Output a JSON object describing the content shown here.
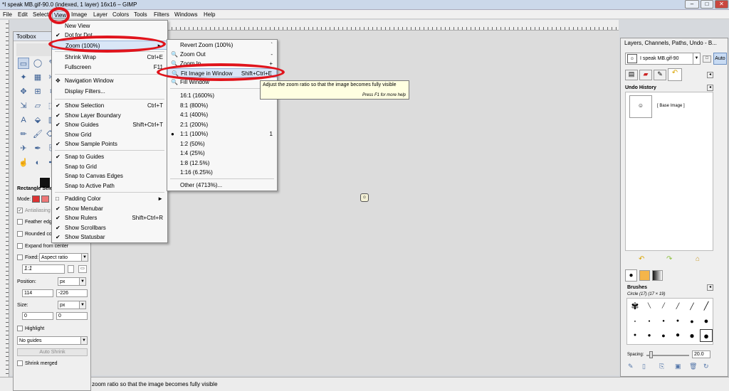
{
  "window": {
    "title": "*I speak MB.gif-90.0 (indexed, 1 layer) 16x16 – GIMP"
  },
  "menubar": {
    "items": [
      "File",
      "Edit",
      "Select",
      "View",
      "Image",
      "Layer",
      "Colors",
      "Tools",
      "Filters",
      "Windows",
      "Help"
    ]
  },
  "view_menu": {
    "items": [
      {
        "label": "New View",
        "check": ""
      },
      {
        "label": "Dot for Dot",
        "check": "✔"
      },
      {
        "label": "Zoom (100%)",
        "check": "",
        "sub": "►"
      },
      {
        "label": "Shrink Wrap",
        "shortcut": "Ctrl+E",
        "check": ""
      },
      {
        "label": "Fullscreen",
        "shortcut": "F11",
        "check": ""
      },
      {
        "label": "Navigation Window",
        "check": "✥"
      },
      {
        "label": "Display Filters...",
        "check": ""
      },
      {
        "label": "Show Selection",
        "shortcut": "Ctrl+T",
        "check": "✔"
      },
      {
        "label": "Show Layer Boundary",
        "check": "✔"
      },
      {
        "label": "Show Guides",
        "shortcut": "Shift+Ctrl+T",
        "check": "✔"
      },
      {
        "label": "Show Grid",
        "check": ""
      },
      {
        "label": "Show Sample Points",
        "check": "✔"
      },
      {
        "label": "Snap to Guides",
        "check": "✔"
      },
      {
        "label": "Snap to Grid",
        "check": ""
      },
      {
        "label": "Snap to Canvas Edges",
        "check": ""
      },
      {
        "label": "Snap to Active Path",
        "check": ""
      },
      {
        "label": "Padding Color",
        "check": "□",
        "sub": "►"
      },
      {
        "label": "Show Menubar",
        "check": "✔"
      },
      {
        "label": "Show Rulers",
        "shortcut": "Shift+Ctrl+R",
        "check": "✔"
      },
      {
        "label": "Show Scrollbars",
        "check": "✔"
      },
      {
        "label": "Show Statusbar",
        "check": "✔"
      }
    ]
  },
  "zoom_menu": {
    "items": [
      {
        "label": "Revert Zoom (100%)",
        "shortcut": "`"
      },
      {
        "label": "Zoom Out",
        "shortcut": "-"
      },
      {
        "label": "Zoom In",
        "shortcut": "+"
      },
      {
        "label": "Fit Image in Window",
        "shortcut": "Shift+Ctrl+E"
      },
      {
        "label": "Fill Window",
        "shortcut": ""
      },
      {
        "label": "16:1  (1600%)",
        "shortcut": ""
      },
      {
        "label": "8:1  (800%)",
        "shortcut": ""
      },
      {
        "label": "4:1  (400%)",
        "shortcut": ""
      },
      {
        "label": "2:1  (200%)",
        "shortcut": ""
      },
      {
        "label": "1:1  (100%)",
        "shortcut": "1"
      },
      {
        "label": "1:2  (50%)",
        "shortcut": ""
      },
      {
        "label": "1:4  (25%)",
        "shortcut": ""
      },
      {
        "label": "1:8  (12.5%)",
        "shortcut": ""
      },
      {
        "label": "1:16  (6.25%)",
        "shortcut": ""
      },
      {
        "label": "Other (4713%)...",
        "shortcut": ""
      }
    ]
  },
  "tooltip": {
    "text": "Adjust the zoom ratio so that the image becomes fully visible",
    "hint": "Press F1 for more help"
  },
  "statusbar": {
    "text": "zoom ratio so that the image becomes fully visible"
  },
  "toolbox": {
    "title": "Toolbox",
    "options_title": "Rectangle Selec",
    "mode_label": "Mode:",
    "antialiasing": "Antialiasing",
    "feather": "Feather edge",
    "rounded": "Rounded co",
    "expand": "Expand from center",
    "fixed_label": "Fixed:",
    "fixed_value": "Aspect ratio",
    "ratio": "1:1",
    "position_label": "Position:",
    "position_unit": "px",
    "pos_x": "114",
    "pos_y": "-226",
    "size_label": "Size:",
    "size_unit": "px",
    "size_w": "0",
    "size_h": "0",
    "highlight": "Highlight",
    "guides": "No guides",
    "autoshrink": "Auto Shrink",
    "shrink_merged": "Shrink merged"
  },
  "dock": {
    "title": "Layers, Channels, Paths, Undo - B...",
    "image_combo": "I speak MB.gif-90",
    "auto_button": "Auto",
    "undo_title": "Undo History",
    "base_image": "[ Base Image ]",
    "brushes_title": "Brushes",
    "brush_name": "Circle (17) (17 × 19)",
    "spacing_label": "Spacing:",
    "spacing_value": "20.0"
  },
  "accent": {
    "highlight_ring": "#e0141c",
    "menu_highlight": "#d9e6f7",
    "tooltip_bg": "#ffffe1"
  }
}
